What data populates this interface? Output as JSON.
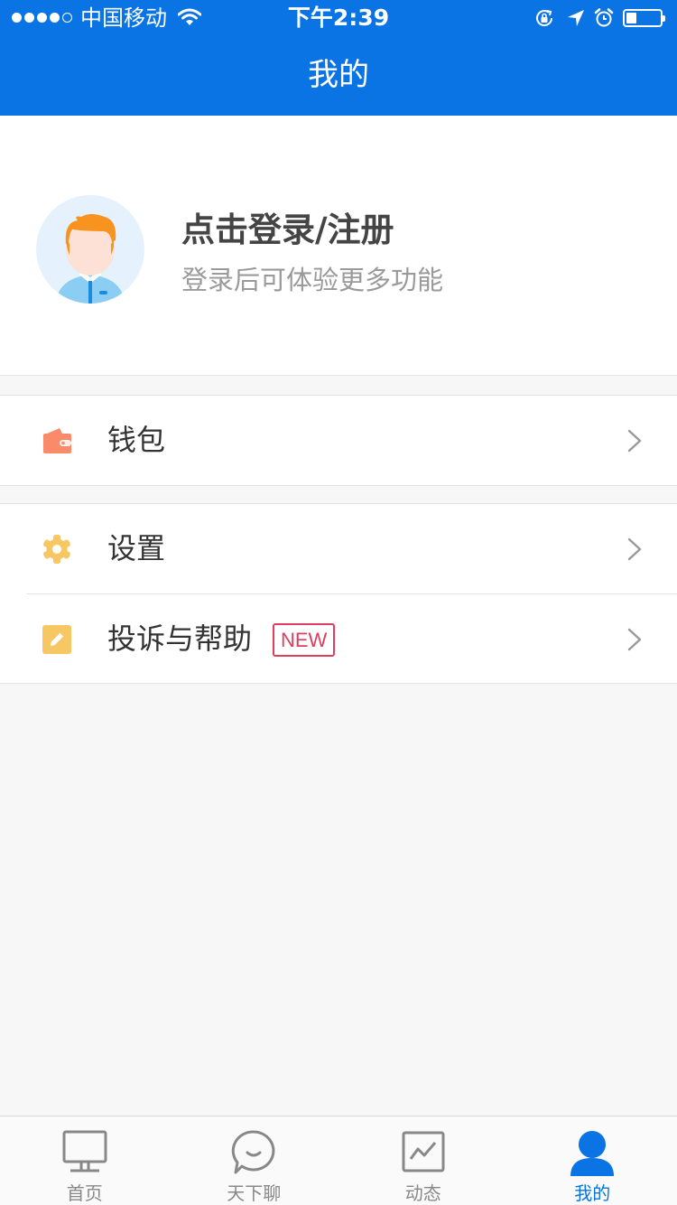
{
  "status_bar": {
    "carrier": "中国移动",
    "time": "下午2:39",
    "signal_bars_filled": 4,
    "signal_bars_total": 5,
    "battery_level": 0.3
  },
  "nav": {
    "title": "我的"
  },
  "profile": {
    "title": "点击登录/注册",
    "subtitle": "登录后可体验更多功能",
    "avatar_icon": "user-avatar"
  },
  "menu": {
    "wallet": {
      "label": "钱包",
      "icon": "wallet-icon"
    },
    "settings": {
      "label": "设置",
      "icon": "gear-icon"
    },
    "feedback": {
      "label": "投诉与帮助",
      "badge": "NEW",
      "icon": "edit-icon"
    }
  },
  "tabbar": {
    "tabs": [
      {
        "label": "首页",
        "icon": "monitor-icon",
        "active": false
      },
      {
        "label": "天下聊",
        "icon": "chat-bubble-icon",
        "active": false
      },
      {
        "label": "动态",
        "icon": "trend-chart-icon",
        "active": false
      },
      {
        "label": "我的",
        "icon": "person-icon",
        "active": true
      }
    ]
  },
  "colors": {
    "primary": "#0b74e5",
    "badge": "#e03d5e",
    "wallet": "#f98b6b",
    "settings": "#f7c764",
    "feedback": "#f7c764"
  }
}
